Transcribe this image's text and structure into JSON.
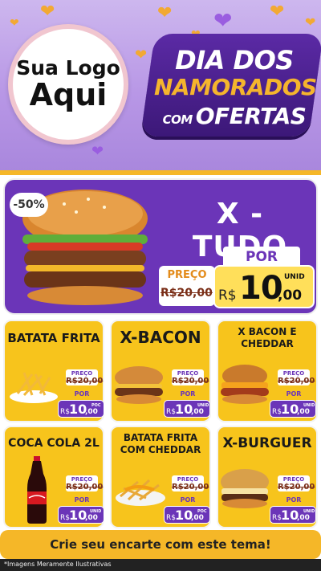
{
  "header": {
    "logo_line1": "Sua Logo",
    "logo_line2": "Aqui",
    "promo_line1": "DIA DOS",
    "promo_line2": "NAMORADOS",
    "promo_line3_small": "COM",
    "promo_line3": "OFERTAS"
  },
  "featured": {
    "badge": "-50%",
    "title": "X - TUDO",
    "por_label": "POR",
    "preco_label": "PREÇO",
    "old_price": "R$20,00",
    "currency": "R$",
    "price_int": "10",
    "price_dec": ",00",
    "unit": "UNID"
  },
  "products": [
    {
      "title": "BATATA FRITA",
      "preco_label": "PREÇO",
      "old_price": "R$20,00",
      "por_label": "POR",
      "currency": "R$",
      "price_int": "10",
      "price_dec": ",00",
      "unit": "POC"
    },
    {
      "title": "X-BACON",
      "preco_label": "PREÇO",
      "old_price": "R$20,00",
      "por_label": "POR",
      "currency": "R$",
      "price_int": "10",
      "price_dec": ",00",
      "unit": "UNID"
    },
    {
      "title": "X BACON E CHEDDAR",
      "preco_label": "PREÇO",
      "old_price": "R$20,00",
      "por_label": "POR",
      "currency": "R$",
      "price_int": "10",
      "price_dec": ",00",
      "unit": "UNID"
    },
    {
      "title": "COCA COLA 2L",
      "preco_label": "PREÇO",
      "old_price": "R$20,00",
      "por_label": "POR",
      "currency": "R$",
      "price_int": "10",
      "price_dec": ",00",
      "unit": "UNID"
    },
    {
      "title": "BATATA FRITA COM CHEDDAR",
      "preco_label": "PREÇO",
      "old_price": "R$20,00",
      "por_label": "POR",
      "currency": "R$",
      "price_int": "10",
      "price_dec": ",00",
      "unit": "POC"
    },
    {
      "title": "X-BURGUER",
      "preco_label": "PREÇO",
      "old_price": "R$20,00",
      "por_label": "POR",
      "currency": "R$",
      "price_int": "10",
      "price_dec": ",00",
      "unit": "UNID"
    }
  ],
  "cta": {
    "label": "Crie seu encarte com este tema!"
  },
  "footer": {
    "note": "*Imagens Meramente Ilustrativas"
  },
  "colors": {
    "purple": "#6b35b8",
    "yellow": "#f7c41c",
    "gold": "#f5b728",
    "lavender": "#b897e6"
  }
}
